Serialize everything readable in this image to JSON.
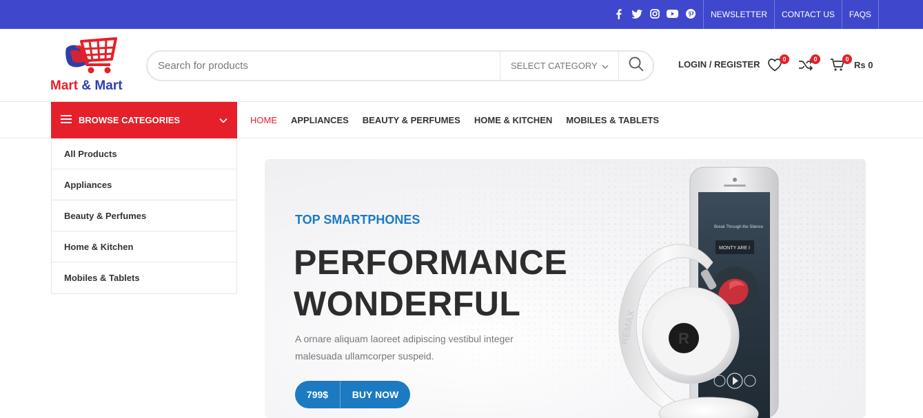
{
  "topbar": {
    "social_icons": [
      "facebook-icon",
      "twitter-icon",
      "instagram-icon",
      "youtube-icon",
      "pinterest-icon"
    ],
    "links": [
      "NEWSLETTER",
      "CONTACT US",
      "FAQS"
    ]
  },
  "header": {
    "logo_text_1": "Mart",
    "logo_amp": "&",
    "logo_text_2": "Mart",
    "search_placeholder": "Search for products",
    "category_select": "SELECT CATEGORY",
    "login": "LOGIN / REGISTER",
    "wishlist_count": "0",
    "compare_count": "0",
    "cart_count": "0",
    "cart_total": "Rs 0"
  },
  "nav": {
    "browse_label": "BROWSE CATEGORIES",
    "items": [
      "HOME",
      "APPLIANCES",
      "BEAUTY & PERFUMES",
      "HOME & KITCHEN",
      "MOBILES & TABLETS"
    ]
  },
  "categories": [
    "All Products",
    "Appliances",
    "Beauty & Perfumes",
    "Home & Kitchen",
    "Mobiles & Tablets"
  ],
  "hero": {
    "kicker": "TOP SMARTPHONES",
    "headline_1": "PERFORMANCE",
    "headline_2": "WONDERFUL",
    "description": "A ornare aliquam laoreet adipiscing vestibul integer malesuada ullamcorper suspeid.",
    "price": "799$",
    "buy_label": "BUY NOW",
    "phone_song": "Break Through the Silence",
    "phone_album": "MONTY ARE I",
    "headphone_brand": "REMAX"
  },
  "colors": {
    "topbar": "#3f48cc",
    "accent_red": "#e5202a",
    "accent_blue": "#1b7ac2"
  }
}
